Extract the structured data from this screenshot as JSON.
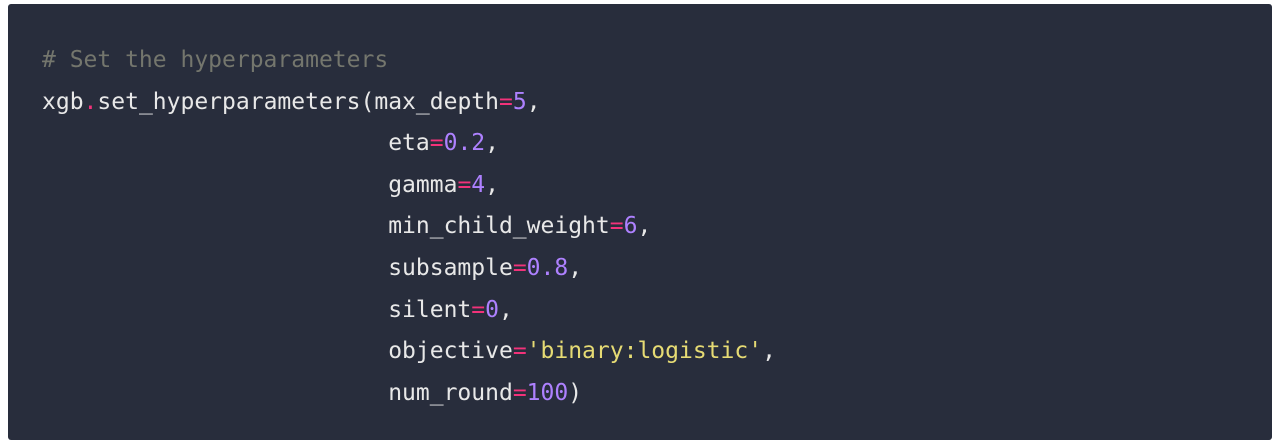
{
  "code": {
    "comment": "# Set the hyperparameters",
    "object": "xgb",
    "dot": ".",
    "method": "set_hyperparameters(",
    "indent": "                         ",
    "params": [
      {
        "name": "max_depth",
        "eq": "=",
        "value": "5",
        "value_type": "num",
        "suffix": ","
      },
      {
        "name": "eta",
        "eq": "=",
        "value": "0.2",
        "value_type": "num",
        "suffix": ","
      },
      {
        "name": "gamma",
        "eq": "=",
        "value": "4",
        "value_type": "num",
        "suffix": ","
      },
      {
        "name": "min_child_weight",
        "eq": "=",
        "value": "6",
        "value_type": "num",
        "suffix": ","
      },
      {
        "name": "subsample",
        "eq": "=",
        "value": "0.8",
        "value_type": "num",
        "suffix": ","
      },
      {
        "name": "silent",
        "eq": "=",
        "value": "0",
        "value_type": "num",
        "suffix": ","
      },
      {
        "name": "objective",
        "eq": "=",
        "value": "'binary:logistic'",
        "value_type": "str",
        "suffix": ","
      },
      {
        "name": "num_round",
        "eq": "=",
        "value": "100",
        "value_type": "num",
        "suffix": ")"
      }
    ]
  },
  "colors": {
    "background": "#282d3c",
    "comment": "#74766d",
    "operator": "#f2327a",
    "number": "#ae81ff",
    "string": "#e6db74",
    "text": "#e8e8e8"
  }
}
